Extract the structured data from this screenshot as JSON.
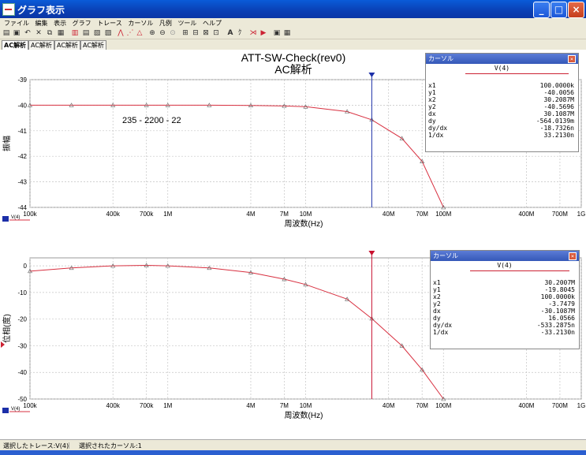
{
  "window": {
    "title": "グラフ表示"
  },
  "menu": [
    "ファイル",
    "編集",
    "表示",
    "グラフ",
    "トレース",
    "カーソル",
    "凡例",
    "ツール",
    "ヘルプ"
  ],
  "tabs": [
    "AC解析",
    "AC解析",
    "AC解析",
    "AC解析"
  ],
  "plot": {
    "title": "ATT-SW-Check(rev0)",
    "subtitle": "AC解析"
  },
  "top_plot": {
    "ylabel": "振幅",
    "xlabel": "周波数(Hz)",
    "annotation": "235 - 2200 - 22",
    "yticks": [
      "-39",
      "-40",
      "-41",
      "-42",
      "-43",
      "-44"
    ],
    "legend_label": "V(4)"
  },
  "bottom_plot": {
    "ylabel": "位相(度)",
    "xlabel": "周波数(Hz)",
    "yticks": [
      "0",
      "-10",
      "-20",
      "-30",
      "-40",
      "-50"
    ],
    "legend_label": "V(4)"
  },
  "xticks": [
    "100k",
    "400k",
    "700k",
    "1M",
    "4M",
    "7M",
    "10M",
    "40M",
    "70M",
    "100M",
    "400M",
    "700M",
    "1G"
  ],
  "chart_data": [
    {
      "type": "line",
      "ylabel": "振幅",
      "xlabel": "周波数(Hz)",
      "xscale": "log",
      "xlim": [
        100000,
        1000000000
      ],
      "ylim": [
        -44,
        -39
      ],
      "grid": true,
      "series": [
        {
          "name": "V(4)",
          "x": [
            100000,
            200000,
            400000,
            700000,
            1000000,
            2000000,
            4000000,
            7000000,
            10000000,
            20000000,
            30200000,
            50000000,
            70000000,
            100000000
          ],
          "y": [
            -40.0,
            -40.0,
            -40.0,
            -40.0,
            -40.0,
            -40.0,
            -40.01,
            -40.03,
            -40.06,
            -40.25,
            -40.57,
            -41.3,
            -42.2,
            -44.0
          ]
        }
      ],
      "cursors": [
        {
          "x": 30200000
        }
      ]
    },
    {
      "type": "line",
      "ylabel": "位相(度)",
      "xlabel": "周波数(Hz)",
      "xscale": "log",
      "xlim": [
        100000,
        1000000000
      ],
      "ylim": [
        -50,
        3
      ],
      "grid": true,
      "series": [
        {
          "name": "V(4)",
          "x": [
            100000,
            200000,
            400000,
            700000,
            1000000,
            2000000,
            4000000,
            7000000,
            10000000,
            20000000,
            30200000,
            50000000,
            70000000,
            100000000
          ],
          "y": [
            -2.0,
            -0.8,
            0.0,
            0.2,
            0.0,
            -0.8,
            -2.5,
            -5.0,
            -7.0,
            -12.5,
            -19.8,
            -30.0,
            -39.0,
            -50.0
          ]
        }
      ],
      "cursors": [
        {
          "x": 30200000
        }
      ]
    }
  ],
  "cursor1": {
    "title": "カーソル",
    "trace": "V(4)",
    "rows": [
      [
        "x1",
        "100.0000k"
      ],
      [
        "y1",
        "-40.0056"
      ],
      [
        "x2",
        "30.2087M"
      ],
      [
        "y2",
        "-40.5696"
      ],
      [
        "dx",
        "30.1087M"
      ],
      [
        "dy",
        "-564.0139m"
      ],
      [
        "dy/dx",
        "-18.7326n"
      ],
      [
        "1/dx",
        "33.2130n"
      ]
    ]
  },
  "cursor2": {
    "title": "カーソル",
    "trace": "V(4)",
    "rows": [
      [
        "x1",
        "30.2007M"
      ],
      [
        "y1",
        "-19.8045"
      ],
      [
        "x2",
        "100.0000k"
      ],
      [
        "y2",
        "-3.7479"
      ],
      [
        "dx",
        "-30.1087M"
      ],
      [
        "dy",
        "16.0566"
      ],
      [
        "dy/dx",
        "-533.2875n"
      ],
      [
        "1/dx",
        "-33.2130n"
      ]
    ]
  },
  "status": {
    "left": "選択したトレース:V(4)",
    "right": "選択されたカーソル:1"
  },
  "colors": {
    "trace": "#d83040",
    "cursor1": "#1c2fa8",
    "cursor2": "#c8102e",
    "grid": "#c4c4c4"
  }
}
